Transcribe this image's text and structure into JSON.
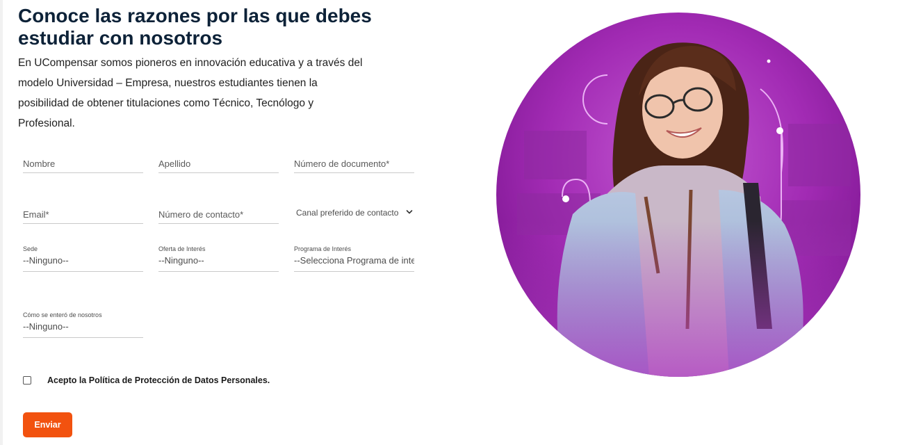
{
  "section": {
    "title": "Conoce las razones por las que debes estudiar con nosotros",
    "intro_lines": [
      "En UCompensar somos pioneros en innovación educativa y a través del",
      "modelo Universidad – Empresa, nuestros estudiantes tienen la",
      "posibilidad de obtener titulaciones como Técnico, Tecnólogo y",
      "Profesional."
    ]
  },
  "form": {
    "nombre_placeholder": "Nombre",
    "apellido_placeholder": "Apellido",
    "documento_placeholder": "Número de documento*",
    "email_placeholder": "Email*",
    "contacto_placeholder": "Número de contacto*",
    "canal": {
      "selected": "Canal preferido de contacto"
    },
    "sede": {
      "label": "Sede",
      "value": "--Ninguno--"
    },
    "oferta": {
      "label": "Oferta de Interés",
      "value": "--Ninguno--"
    },
    "programa": {
      "label": "Programa de Interés",
      "value": "--Selecciona Programa de inter"
    },
    "como": {
      "label": "Cómo se enteró de nosotros",
      "value": "--Ninguno--"
    },
    "consent_label": "Acepto la Política de Protección de Datos Personales.",
    "submit_label": "Enviar"
  },
  "colors": {
    "heading": "#0d2238",
    "accent": "#f2520f",
    "hero_purple": "#9b1fa8"
  },
  "icons": {
    "select_arrow": "chevron-down-icon"
  }
}
